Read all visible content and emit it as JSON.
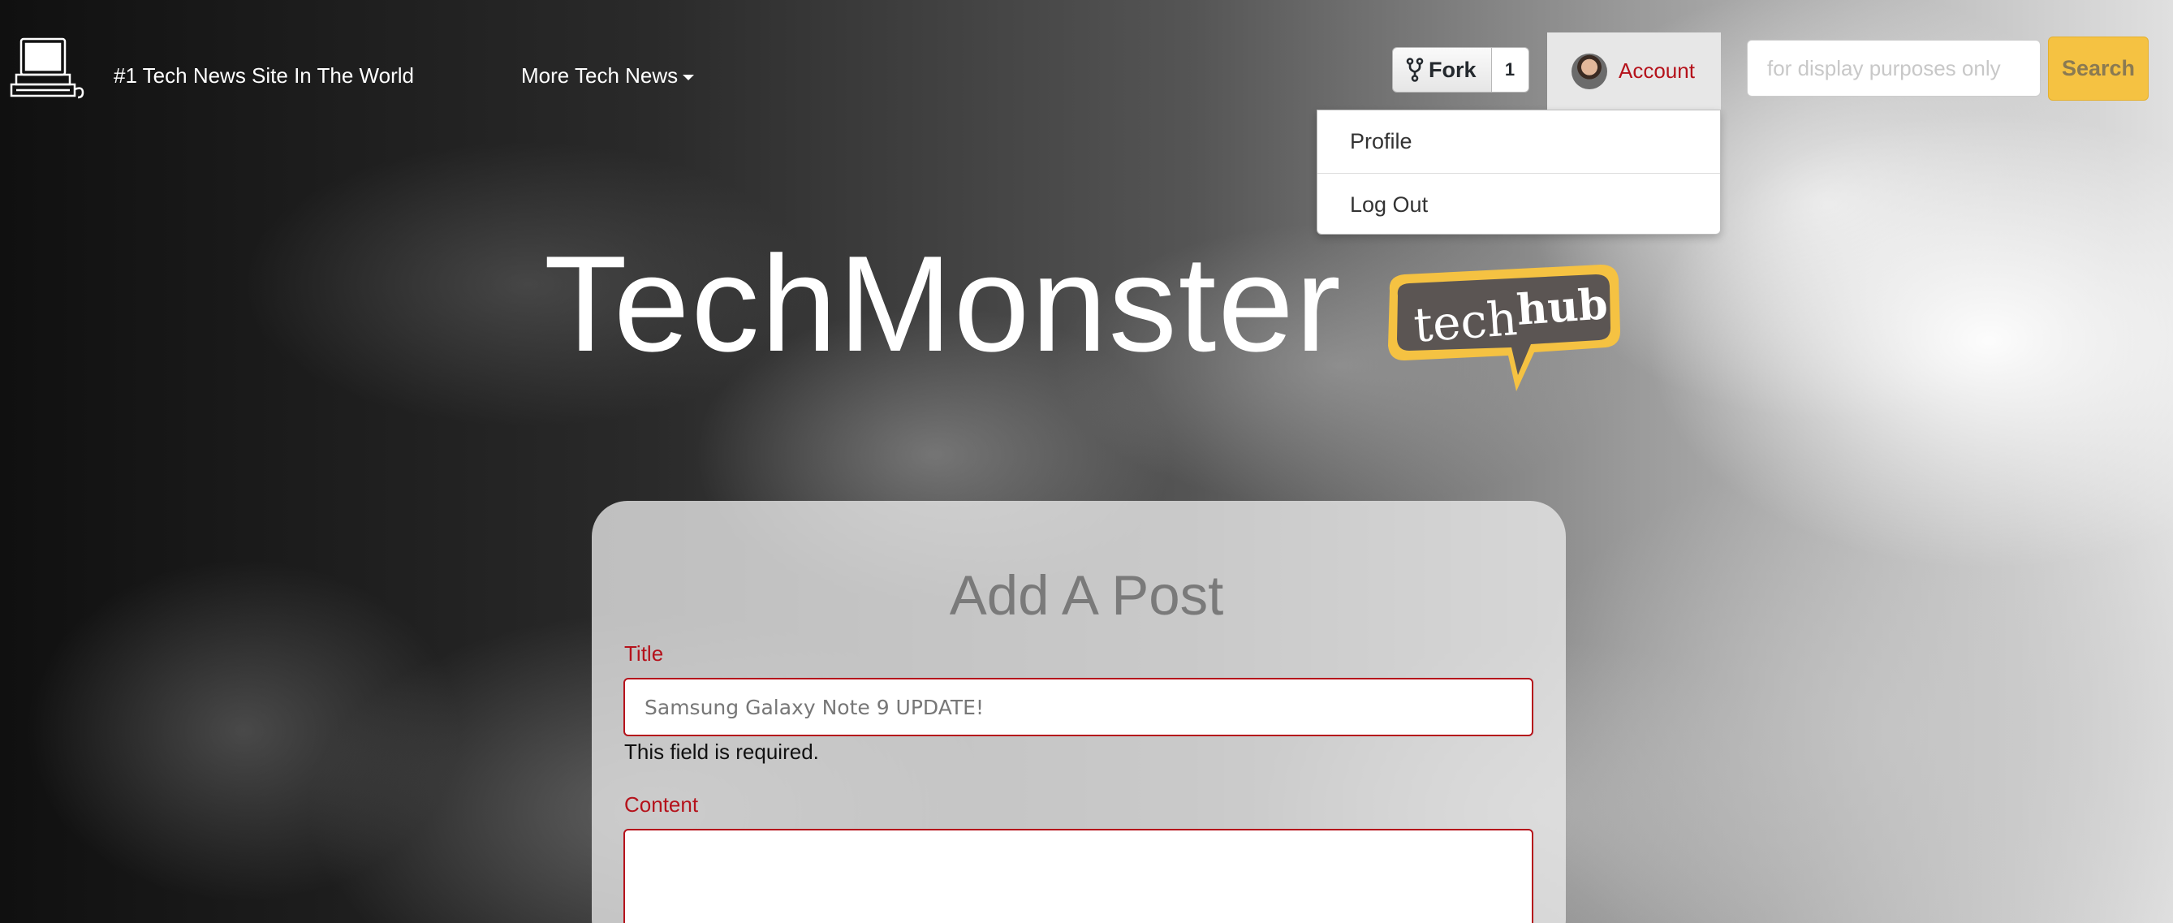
{
  "navbar": {
    "brand": "#1 Tech News Site In The World",
    "more_news": "More Tech News",
    "fork_label": "Fork",
    "fork_count": "1",
    "account_label": "Account",
    "search_placeholder": "for display purposes only",
    "search_button": "Search"
  },
  "account_menu": {
    "items": [
      {
        "label": "Profile"
      },
      {
        "label": "Log Out"
      }
    ]
  },
  "hero": {
    "title": "TechMonster",
    "badge_logo": "techhub"
  },
  "form": {
    "heading": "Add A Post",
    "title_label": "Title",
    "title_value": "Samsung Galaxy Note 9 UPDATE!",
    "title_error": "This field is required.",
    "content_label": "Content",
    "content_value": ""
  },
  "colors": {
    "accent_red": "#b5121b",
    "search_yellow": "#f5c242",
    "badge_yellow": "#f5c242",
    "badge_gray": "#5b5553"
  },
  "icons": [
    "computer-icon",
    "fork-icon",
    "caret-down-icon",
    "avatar"
  ]
}
